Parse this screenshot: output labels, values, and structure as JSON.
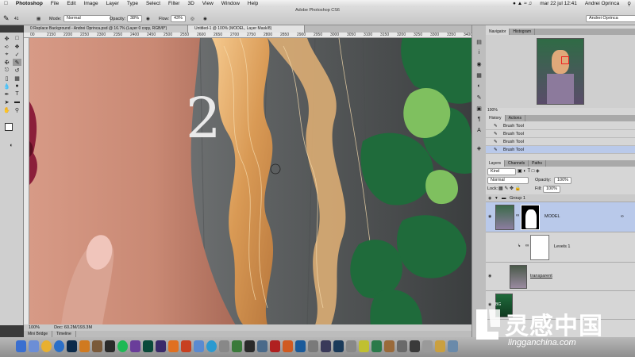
{
  "menubar": {
    "app": "Photoshop",
    "items": [
      "File",
      "Edit",
      "Image",
      "Layer",
      "Type",
      "Select",
      "Filter",
      "3D",
      "View",
      "Window",
      "Help"
    ],
    "clock": "mar 22 jul  12:41",
    "user": "Andrei Oprinca"
  },
  "window_title": "Adobe Photoshop CS6",
  "options": {
    "mode_label": "Mode:",
    "mode_value": "Normal",
    "opacity_label": "Opacity:",
    "opacity_value": "38%",
    "flow_label": "Flow:",
    "flow_value": "43%",
    "brush_size": "41",
    "workspace": "Andrei Oprinca"
  },
  "tabs": [
    {
      "label": "0 Replace Background - Andrei Oprinca.psd @ 16.7% (Layer 0 copy, RGB/8*)",
      "active": false
    },
    {
      "label": "Untitled-1 @ 100% (MODEL, Layer Mask/8)",
      "active": true
    }
  ],
  "ruler_ticks": [
    "00",
    "2150",
    "2200",
    "2250",
    "2300",
    "2350",
    "2400",
    "2450",
    "2500",
    "2550",
    "2600",
    "2650",
    "2700",
    "2750",
    "2800",
    "2850",
    "2900",
    "2950",
    "3000",
    "3050",
    "3100",
    "3150",
    "3200",
    "3250",
    "3300",
    "3350",
    "3400"
  ],
  "canvas": {
    "overlay_number": "2"
  },
  "status": {
    "zoom": "100%",
    "doc": "Doc: 60.2M/193.3M"
  },
  "bottom_tabs": [
    "Mini Bridge",
    "Timeline"
  ],
  "navigator": {
    "tabs": [
      "Navigator",
      "Histogram"
    ],
    "zoom": "100%"
  },
  "history": {
    "tabs": [
      "History",
      "Actions"
    ],
    "items": [
      "Brush Tool",
      "Brush Tool",
      "Brush Tool",
      "Brush Tool"
    ],
    "selected_index": 3
  },
  "layers": {
    "tabs": [
      "Layers",
      "Channels",
      "Paths"
    ],
    "kind": "Kind",
    "blend": "Normal",
    "opacity_label": "Opacity:",
    "opacity": "100%",
    "lock_label": "Lock:",
    "fill_label": "Fill:",
    "fill": "100%",
    "group_name": "Group 1",
    "rows": [
      {
        "name": "MODEL",
        "selected": true
      },
      {
        "name": "Levels 1",
        "selected": false
      },
      {
        "name": "transparent",
        "selected": false
      },
      {
        "name": "BG",
        "selected": false
      }
    ]
  },
  "watermark": {
    "brand": "灵感中国",
    "url": "lingganchina.com"
  },
  "colors": {
    "selection": "#b9c9ea",
    "leaf_dark": "#1f6b3b",
    "leaf_light": "#7fc05f"
  }
}
